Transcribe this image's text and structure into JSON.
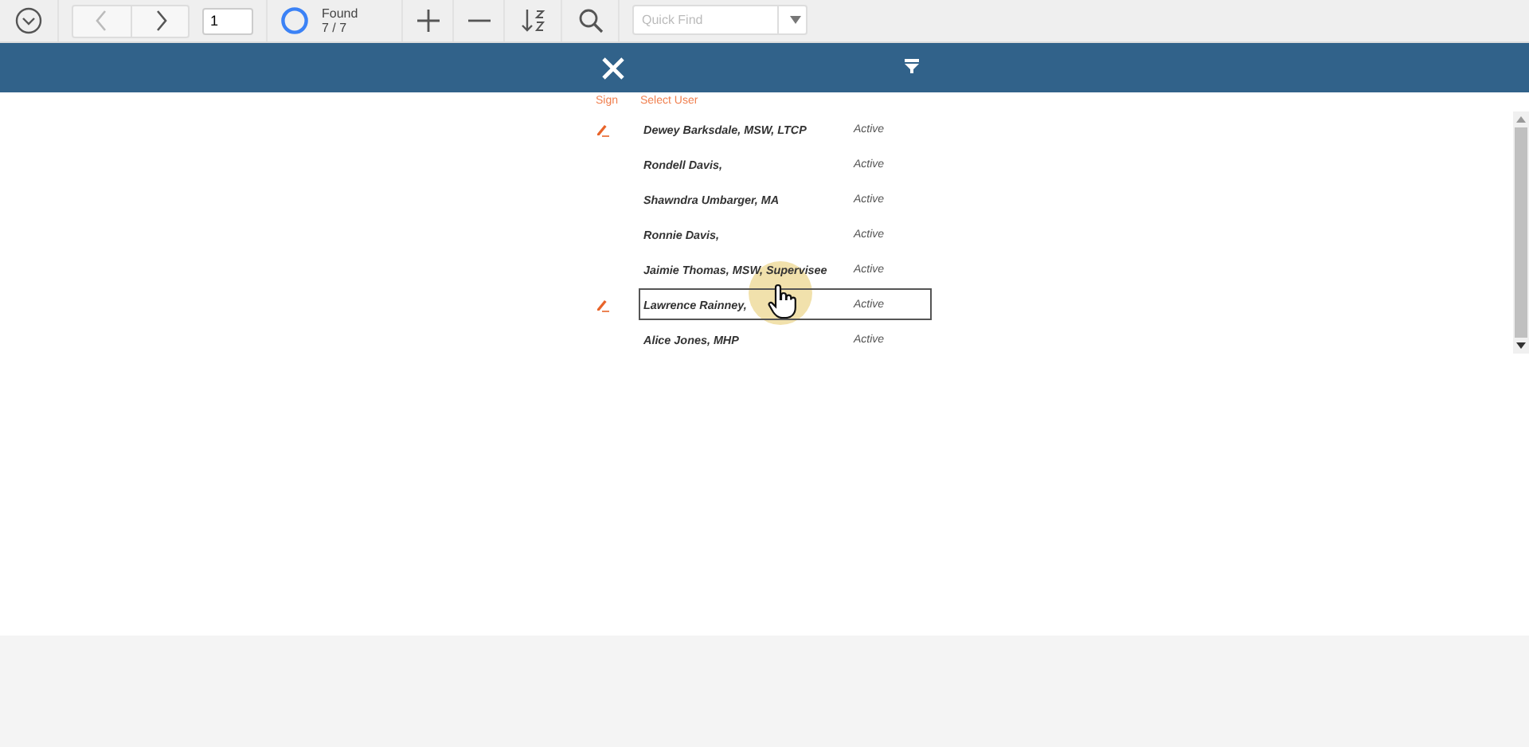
{
  "toolbar": {
    "page": "1",
    "found_label": "Found",
    "found_count": "7 / 7",
    "quick_find_placeholder": "Quick Find"
  },
  "header": {
    "sign": "Sign",
    "select_user": "Select User"
  },
  "users": [
    {
      "name": "Dewey Barksdale, MSW, LTCP",
      "status": "Active",
      "signed": true,
      "selected": false
    },
    {
      "name": "Rondell Davis,",
      "status": "Active",
      "signed": false,
      "selected": false
    },
    {
      "name": "Shawndra Umbarger, MA",
      "status": "Active",
      "signed": false,
      "selected": false
    },
    {
      "name": "Ronnie Davis,",
      "status": "Active",
      "signed": false,
      "selected": false
    },
    {
      "name": "Jaimie Thomas, MSW, Supervisee",
      "status": "Active",
      "signed": false,
      "selected": false
    },
    {
      "name": "Lawrence Rainney,",
      "status": "Active",
      "signed": true,
      "selected": true
    },
    {
      "name": "Alice Jones, MHP",
      "status": "Active",
      "signed": false,
      "selected": false
    }
  ]
}
